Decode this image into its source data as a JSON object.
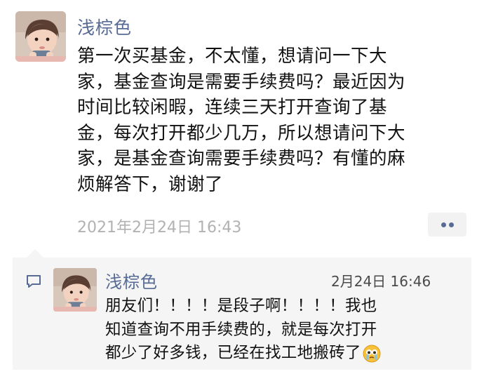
{
  "post": {
    "author": "浅棕色",
    "avatar_icon": "toddler-avatar",
    "lines": [
      "第一次买基金，不太懂，想请问一下大",
      "家，基金查询是需要手续费吗？最近因为",
      "时间比较闲暇，连续三天打开查询了基",
      "金，每次打开都少几万，所以想请问下大",
      "家，是基金查询需要手续费吗？有懂的麻",
      "烦解答下，谢谢了"
    ],
    "timestamp": "2021年2月24日 16:43",
    "more_icon": "more-dots-icon"
  },
  "comment": {
    "icon": "comment-icon",
    "author": "浅棕色",
    "time": "2月24日 16:46",
    "lines": [
      "朋友们！！！！是段子啊！！！！我也",
      "知道查询不用手续费的，就是每次打开",
      "都少了好多钱，已经在找工地搬砖了"
    ],
    "emoji_icon": "crying-face-emoji"
  },
  "colors": {
    "name": "#576b95",
    "timestamp": "#b2b2b2",
    "comment_bg": "#f5f5f5",
    "text": "#111111"
  }
}
